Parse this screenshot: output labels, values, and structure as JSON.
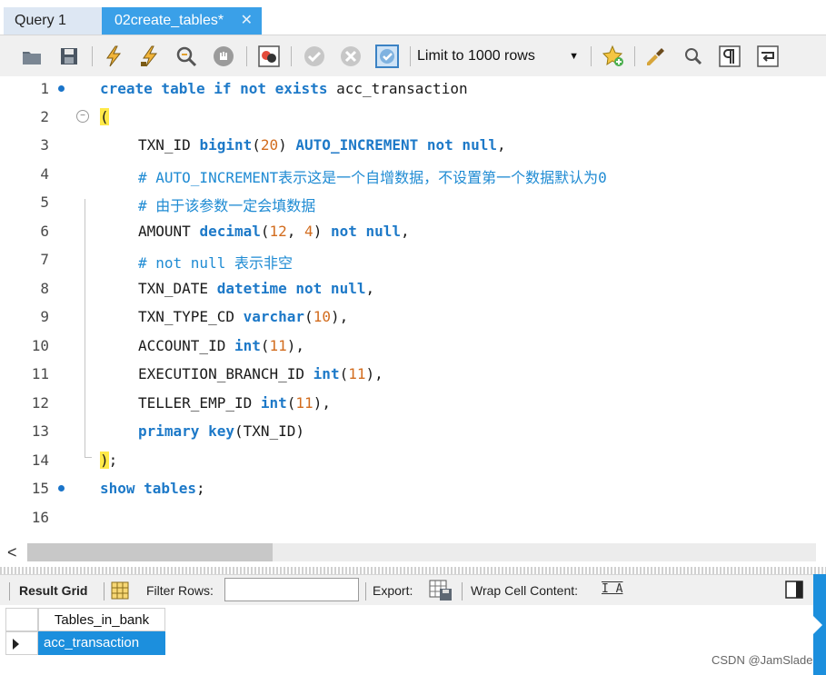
{
  "tabs": [
    {
      "label": "Query 1",
      "active": false
    },
    {
      "label": "02create_tables*",
      "active": true,
      "close_icon": "close-icon"
    }
  ],
  "toolbar": {
    "limit_select": "Limit to 1000 rows",
    "icons": [
      "open-folder-icon",
      "save-icon",
      "execute-icon",
      "execute-current-icon",
      "explain-icon",
      "stop-icon",
      "toggle-error-icon",
      "commit-icon",
      "rollback-icon",
      "autocommit-icon",
      "chevron-down-icon",
      "bookmark-star-icon",
      "beautify-icon",
      "find-icon",
      "invisible-chars-icon",
      "wrap-lines-icon"
    ]
  },
  "editor": {
    "lines": [
      {
        "n": "1"
      },
      {
        "n": "2"
      },
      {
        "n": "3"
      },
      {
        "n": "4"
      },
      {
        "n": "5"
      },
      {
        "n": "6"
      },
      {
        "n": "7"
      },
      {
        "n": "8"
      },
      {
        "n": "9"
      },
      {
        "n": "10"
      },
      {
        "n": "11"
      },
      {
        "n": "12"
      },
      {
        "n": "13"
      },
      {
        "n": "14"
      },
      {
        "n": "15"
      },
      {
        "n": "16"
      }
    ],
    "tokens": {
      "l1_kw": "create table if not exists",
      "l1_id": "acc_transaction",
      "l2": "(",
      "l3_id": "TXN_ID",
      "l3_type": "bigint",
      "l3_num": "20",
      "l3_kw": "AUTO_INCREMENT not null",
      "l4": "# AUTO_INCREMENT表示这是一个自增数据，不设置第一个数据默认为0",
      "l5": "# 由于该参数一定会填数据",
      "l6_id": "AMOUNT",
      "l6_type": "decimal",
      "l6_num1": "12",
      "l6_num2": "4",
      "l6_kw": "not null",
      "l7": "# not null 表示非空",
      "l8_id": "TXN_DATE",
      "l8_kw": "datetime not null",
      "l9_id": "TXN_TYPE_CD",
      "l9_type": "varchar",
      "l9_num": "10",
      "l10_id": "ACCOUNT_ID",
      "l10_type": "int",
      "l10_num": "11",
      "l11_id": "EXECUTION_BRANCH_ID",
      "l11_type": "int",
      "l11_num": "11",
      "l12_id": "TELLER_EMP_ID",
      "l12_type": "int",
      "l12_num": "11",
      "l13_kw": "primary key",
      "l13_id": "TXN_ID",
      "l14": ")",
      "l15_kw": "show tables"
    }
  },
  "scroll": {
    "left_arrow": "<"
  },
  "result": {
    "result_grid_label": "Result Grid",
    "filter_rows_label": "Filter Rows:",
    "filter_value": "",
    "export_label": "Export:",
    "wrap_label": "Wrap Cell Content:",
    "column_header": "Tables_in_bank",
    "rows": [
      "acc_transaction"
    ]
  },
  "watermark": "CSDN @JamSlade",
  "colors": {
    "accent": "#1c8fdd",
    "keyword": "#1d79c8",
    "number": "#d26c1e",
    "comment": "#1f8bd3"
  }
}
